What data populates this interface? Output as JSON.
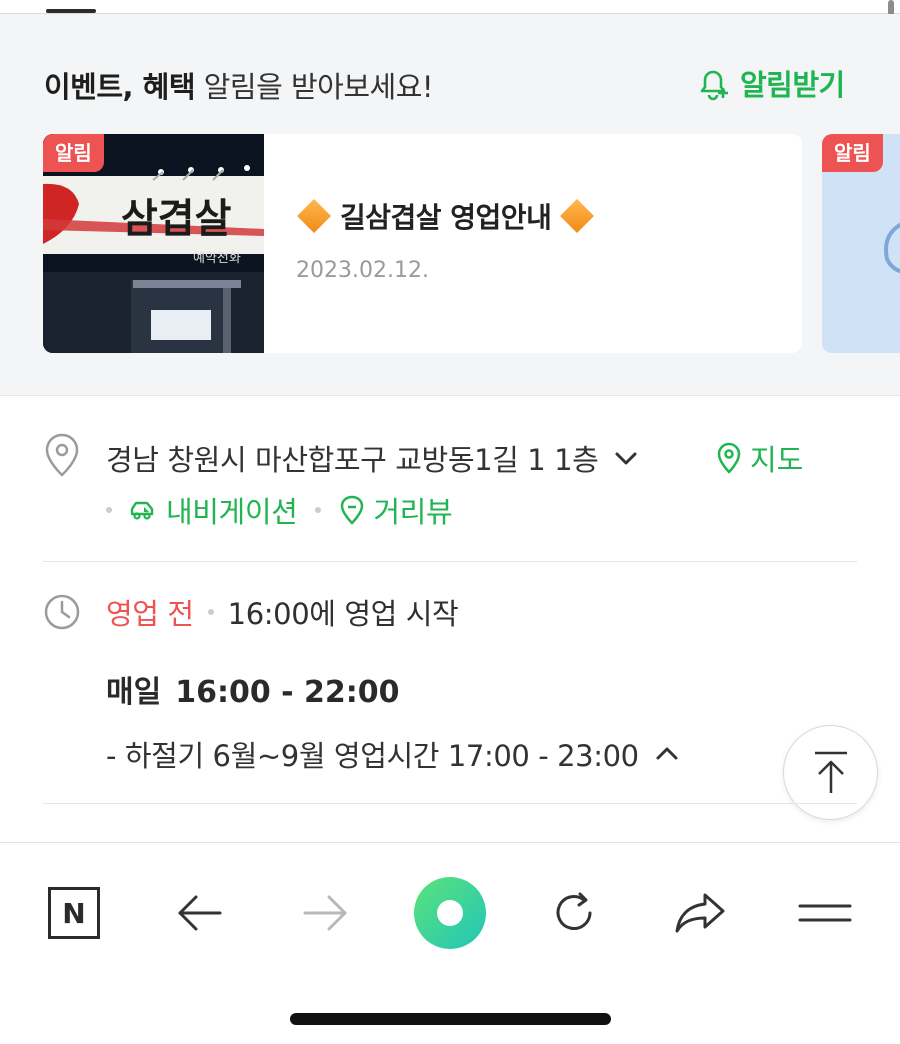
{
  "event": {
    "title_bold": "이벤트, 혜택",
    "title_rest": " 알림을 받아보세요!",
    "alarm_button": "알림받기",
    "cards": [
      {
        "badge": "알림",
        "headline": "길삼겹살 영업안내",
        "date": "2023.02.12.",
        "sign_text": "삼겹살",
        "sign_sub": "예약전화"
      },
      {
        "badge": "알림"
      }
    ]
  },
  "place": {
    "address": "경남 창원시 마산합포구 교방동1길 1 1층",
    "map_link": "지도",
    "navigation_link": "내비게이션",
    "streetview_link": "거리뷰",
    "status": "영업 전",
    "status_detail": "16:00에 영업 시작",
    "hours_day": "매일",
    "hours_time": "16:00 - 22:00",
    "hours_note": "- 하절기 6월~9월 영업시간 17:00 - 23:00"
  },
  "toolbar": {
    "n_label": "N"
  },
  "colors": {
    "accent_green": "#21b552",
    "alert_red": "#ee5353"
  }
}
